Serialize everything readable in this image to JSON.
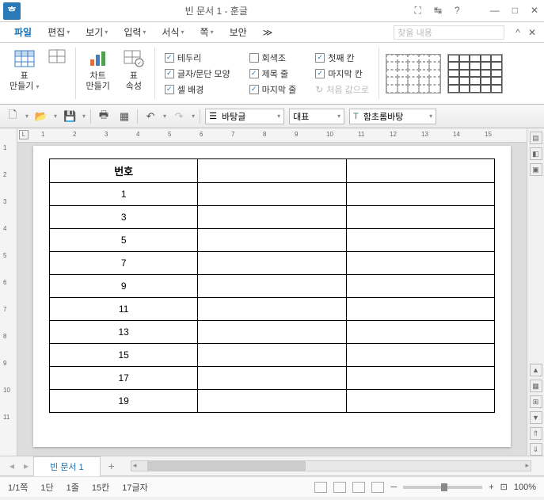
{
  "title": "빈 문서 1 - 훈글",
  "app_glyph": "ᄒ",
  "menu": {
    "file": "파일",
    "edit": "편집",
    "view": "보기",
    "input": "입력",
    "format": "서식",
    "page": "쪽",
    "security": "보안",
    "more": "≫",
    "search_placeholder": "찾을 내용"
  },
  "ribbon": {
    "table_make": "표\n만들기",
    "chart_make": "차트\n만들기",
    "table_props": "표\n속성",
    "checks": {
      "border": "테두리",
      "text_shape": "글자/문단 모양",
      "cell_bg": "셀 배경",
      "gray": "회색조",
      "title_row": "제목 줄",
      "last_row": "마지막 줄",
      "first_col": "첫째 칸",
      "last_col": "마지막 칸",
      "default_val": "처음 값으로"
    }
  },
  "toolbar": {
    "style": "바탕글",
    "rep": "대표",
    "font": "함초롬바탕"
  },
  "doc": {
    "header": "번호",
    "rows": [
      "1",
      "3",
      "5",
      "7",
      "9",
      "11",
      "13",
      "15",
      "17",
      "19"
    ]
  },
  "tab": {
    "name": "빈 문서 1"
  },
  "status": {
    "page": "1/1쪽",
    "section": "1단",
    "line": "1줄",
    "col": "15칸",
    "chars": "17글자",
    "zoom": "100%"
  },
  "hruler": [
    1,
    2,
    3,
    4,
    5,
    6,
    7,
    8,
    9,
    10,
    11,
    12,
    13,
    14,
    15
  ],
  "vruler": [
    1,
    2,
    3,
    4,
    5,
    6,
    7,
    8,
    9,
    10,
    11
  ]
}
